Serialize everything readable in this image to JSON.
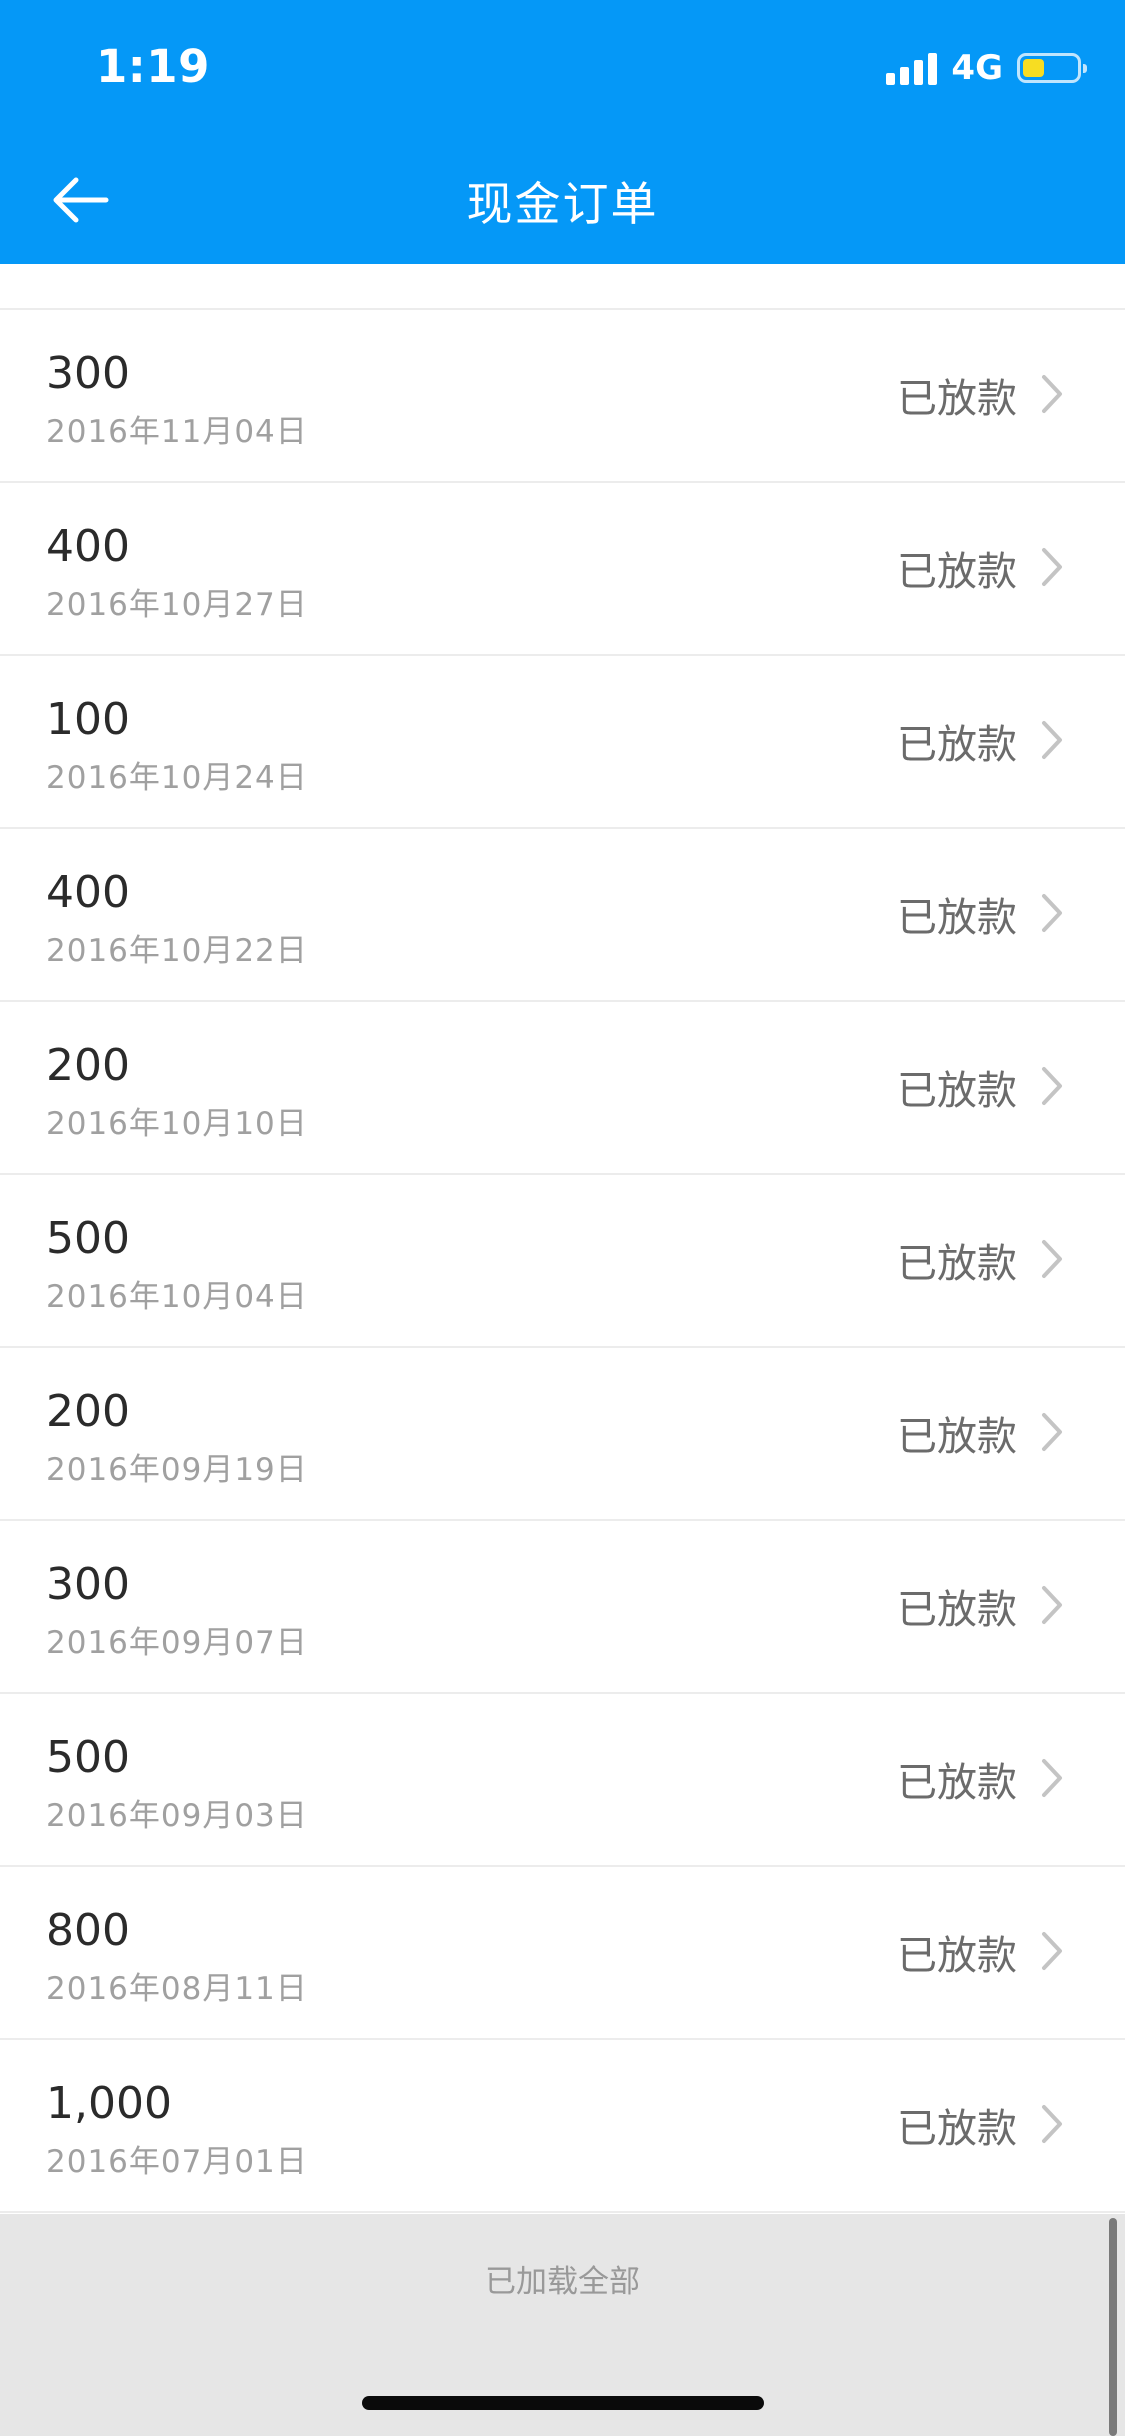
{
  "status_bar": {
    "time": "1:19",
    "network": "4G",
    "battery_level_fraction": 0.4
  },
  "nav": {
    "title": "现金订单",
    "back_icon": "arrow-left-icon"
  },
  "orders": [
    {
      "amount": "300",
      "date": "2016年11月04日",
      "status": "已放款"
    },
    {
      "amount": "400",
      "date": "2016年10月27日",
      "status": "已放款"
    },
    {
      "amount": "100",
      "date": "2016年10月24日",
      "status": "已放款"
    },
    {
      "amount": "400",
      "date": "2016年10月22日",
      "status": "已放款"
    },
    {
      "amount": "200",
      "date": "2016年10月10日",
      "status": "已放款"
    },
    {
      "amount": "500",
      "date": "2016年10月04日",
      "status": "已放款"
    },
    {
      "amount": "200",
      "date": "2016年09月19日",
      "status": "已放款"
    },
    {
      "amount": "300",
      "date": "2016年09月07日",
      "status": "已放款"
    },
    {
      "amount": "500",
      "date": "2016年09月03日",
      "status": "已放款"
    },
    {
      "amount": "800",
      "date": "2016年08月11日",
      "status": "已放款"
    },
    {
      "amount": "1,000",
      "date": "2016年07月01日",
      "status": "已放款"
    }
  ],
  "footer": {
    "text": "已加载全部"
  },
  "colors": {
    "header_bg": "#0598f7",
    "footer_bg": "#e6e6e6",
    "battery_fill": "#f7dd22"
  }
}
